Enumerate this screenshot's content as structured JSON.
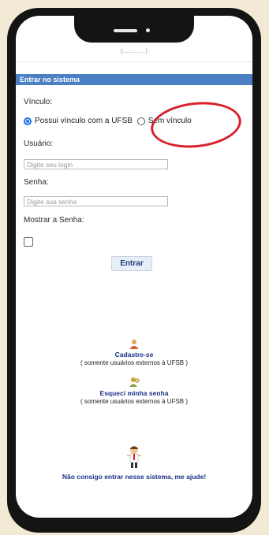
{
  "header": {
    "partial_text": "(...............)"
  },
  "section": {
    "title": "Entrar no sistema"
  },
  "vinculo": {
    "label": "Vínculo:",
    "options": [
      {
        "label": "Possui vínculo com a UFSB",
        "checked": true
      },
      {
        "label": "Sem vínculo",
        "checked": false
      }
    ]
  },
  "usuario": {
    "label": "Usuário:",
    "placeholder": "Digite seu login"
  },
  "senha": {
    "label": "Senha:",
    "placeholder": "Digite sua senha"
  },
  "mostrar": {
    "label": "Mostrar a Senha:"
  },
  "submit": {
    "label": "Entrar"
  },
  "cadastro": {
    "title": "Cadastre-se",
    "note": "( somente usuários externos à UFSB )"
  },
  "esqueci": {
    "title": "Esqueci minha senha",
    "note": "( somente usuários externos à UFSB )"
  },
  "ajuda": {
    "text": "Não consigo entrar nesse sistema, me ajude!"
  },
  "colors": {
    "section_bar": "#4b80c4",
    "link": "#1b2f86",
    "highlight": "#d8202a",
    "background": "#f3ead6"
  }
}
